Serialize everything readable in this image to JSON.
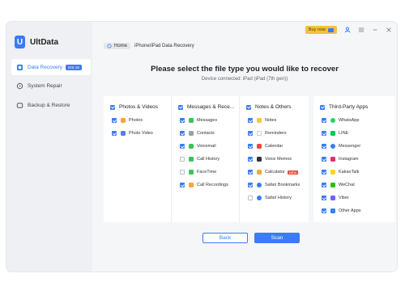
{
  "app": {
    "name": "UltData",
    "logo_letter": "U"
  },
  "sidebar": {
    "items": [
      {
        "label": "Data Recovery",
        "badge": "iOS 18",
        "icon": "recover-icon"
      },
      {
        "label": "System Repair",
        "icon": "wrench-icon"
      },
      {
        "label": "Backup & Restore",
        "icon": "backup-icon"
      }
    ]
  },
  "topbar": {
    "buy_label": "Buy now"
  },
  "breadcrumb": {
    "home": "Home",
    "current": "iPhone/iPad Data Recovery"
  },
  "main": {
    "title": "Please select the file type you would like to recover",
    "device": "Device connected: iPad (iPad (7th gen))"
  },
  "categories": {
    "photos": {
      "title": "Photos & Videos",
      "items": [
        {
          "label": "Photos",
          "checked": true,
          "color": "#f0a83c"
        },
        {
          "label": "Photo Video",
          "checked": true,
          "color": "#5b7de8"
        }
      ]
    },
    "messages": {
      "title": "Messages & Rece...",
      "items": [
        {
          "label": "Messages",
          "checked": true,
          "color": "#3cc25a"
        },
        {
          "label": "Contacts",
          "checked": true,
          "color": "#9aa0a8"
        },
        {
          "label": "Voicemail",
          "checked": true,
          "color": "#3cc25a"
        },
        {
          "label": "Call History",
          "checked": false,
          "color": "#3cc25a"
        },
        {
          "label": "FaceTime",
          "checked": false,
          "color": "#3cc25a"
        },
        {
          "label": "Call Recordings",
          "checked": true,
          "color": "#f0a83c"
        }
      ]
    },
    "notes": {
      "title": "Notes & Others",
      "items": [
        {
          "label": "Notes",
          "checked": true,
          "color": "#f4c844"
        },
        {
          "label": "Reminders",
          "checked": true,
          "color": "#ffffff"
        },
        {
          "label": "Calendar",
          "checked": true,
          "color": "#e94b3c"
        },
        {
          "label": "Voice Memos",
          "checked": true,
          "color": "#333333"
        },
        {
          "label": "Calculator",
          "checked": true,
          "color": "#f0a83c",
          "tag": "NEW"
        },
        {
          "label": "Safari Bookmarks",
          "checked": true,
          "color": "#3a7bf6"
        },
        {
          "label": "Safari History",
          "checked": false,
          "color": "#3a7bf6"
        }
      ]
    },
    "third_party": {
      "title": "Third-Party Apps",
      "items": [
        {
          "label": "WhatsApp",
          "checked": true,
          "color": "#25d366"
        },
        {
          "label": "LINE",
          "checked": true,
          "color": "#06c755"
        },
        {
          "label": "Messenger",
          "checked": true,
          "color": "#3a7bf6"
        },
        {
          "label": "Instagram",
          "checked": true,
          "color": "#e1306c"
        },
        {
          "label": "KakaoTalk",
          "checked": true,
          "color": "#f9d71c"
        },
        {
          "label": "WeChat",
          "checked": true,
          "color": "#2dc100"
        },
        {
          "label": "Viber",
          "checked": true,
          "color": "#7360f2"
        },
        {
          "label": "Other Apps",
          "checked": true,
          "color": "#3a7bf6"
        }
      ]
    }
  },
  "buttons": {
    "back": "Back",
    "scan": "Scan"
  },
  "colors": {
    "accent": "#3a7bf6",
    "buy": "#f3c23a"
  }
}
